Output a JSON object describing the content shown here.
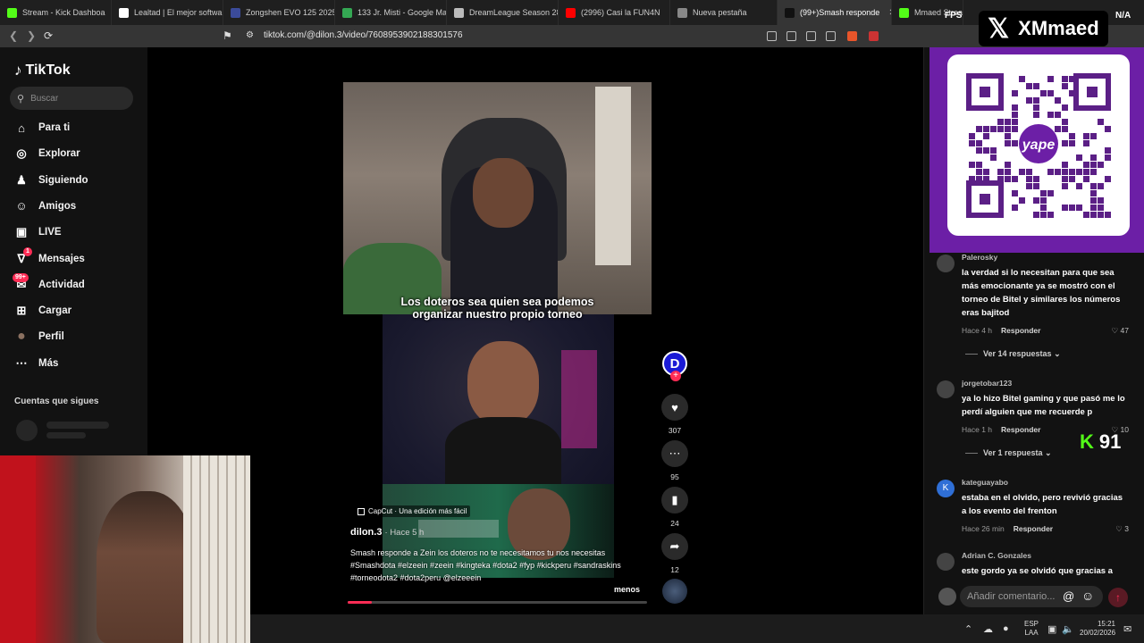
{
  "browser": {
    "tabs": [
      {
        "label": "Stream - Kick Dashboa",
        "color": "#53fc18"
      },
      {
        "label": "Lealtad | El mejor software",
        "color": "#ffffff"
      },
      {
        "label": "Zongshen EVO 125 2025 |",
        "color": "#3b4b9a"
      },
      {
        "label": "133 Jr. Misti - Google Map",
        "color": "#34a853"
      },
      {
        "label": "DreamLeague Season 28:",
        "color": "#bbbbbb"
      },
      {
        "label": "(2996) Casi la FUN4N",
        "color": "#ff0000"
      },
      {
        "label": "Nueva pestaña",
        "color": "#888888"
      },
      {
        "label": "(99+)Smash responde",
        "color": "#111111"
      },
      {
        "label": "Mmaed Stream",
        "color": "#53fc18"
      }
    ],
    "active_tab_index": 7,
    "url": "tiktok.com/@dilon.3/video/7608953902188301576"
  },
  "overlay": {
    "brand": "XMmaed",
    "fps_label": "FPS",
    "fps_value": "N/A",
    "kick_count": "91"
  },
  "sidebar": {
    "logo": "TikTok",
    "search_placeholder": "Buscar",
    "items": [
      {
        "label": "Para ti",
        "icon": "home-icon"
      },
      {
        "label": "Explorar",
        "icon": "compass-icon"
      },
      {
        "label": "Siguiendo",
        "icon": "following-icon"
      },
      {
        "label": "Amigos",
        "icon": "friends-icon"
      },
      {
        "label": "LIVE",
        "icon": "live-icon"
      },
      {
        "label": "Mensajes",
        "icon": "message-icon",
        "badge": "1"
      },
      {
        "label": "Actividad",
        "icon": "activity-icon",
        "badge": "99+"
      },
      {
        "label": "Cargar",
        "icon": "upload-icon"
      },
      {
        "label": "Perfil",
        "icon": "profile-avatar"
      },
      {
        "label": "Más",
        "icon": "more-icon"
      }
    ],
    "following_title": "Cuentas que sigues"
  },
  "video": {
    "caption_line1": "Los doteros sea quien sea podemos",
    "caption_line2": "organizar nuestro propio torneo",
    "capcut": "CapCut · Una edición más fácil",
    "author": "dilon.3",
    "time": "· Hace 5 h",
    "description": "Smash responde a Zein los doteros no te necesitamos tu nos necesitas #Smashdota #elzeein #zeein #kingteka #dota2 #fyp #kickperu #sandraskins #torneodota2 #dota2peru @elzeeein",
    "less": "menos",
    "progress": 0.08
  },
  "actions": {
    "avatar_letter": "D",
    "likes": "307",
    "comments": "95",
    "saves": "24",
    "shares": "12"
  },
  "comments": [
    {
      "user": "Palerosky",
      "text": "la verdad si lo necesitan para que sea más emocionante ya se mostró con el torneo de Bitel y similares los números eras bajitod",
      "time": "Hace 4 h",
      "reply": "Responder",
      "likes": "47",
      "replies": "Ver 14 respuestas"
    },
    {
      "user": "jorgetobar123",
      "text": "ya lo hizo Bitel gaming y que pasó me lo perdí alguien que me recuerde p",
      "time": "Hace 1 h",
      "reply": "Responder",
      "likes": "10",
      "replies": "Ver 1 respuesta"
    },
    {
      "user": "kateguayabo",
      "avatar_letter": "K",
      "text": "estaba en el olvido, pero revivió gracias a los evento del frenton",
      "time": "Hace 26 min",
      "reply": "Responder",
      "likes": "3"
    },
    {
      "user": "Adrian C. Gonzales",
      "text": "este gordo ya se olvidó que gracias a"
    }
  ],
  "comment_input_placeholder": "Añadir comentario...",
  "taskbar": {
    "lang1": "ESP",
    "lang2": "LAA",
    "time": "15:21",
    "date": "20/02/2026"
  }
}
